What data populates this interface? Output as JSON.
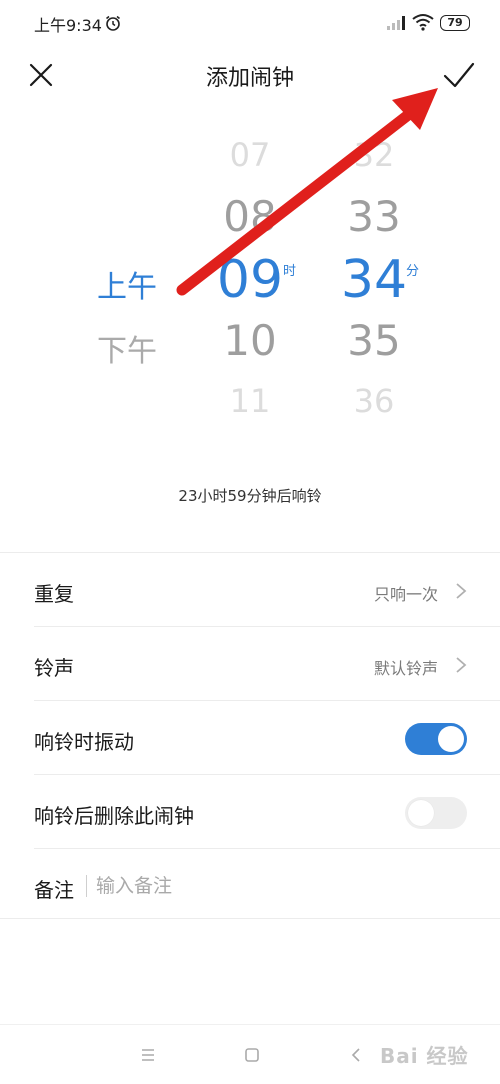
{
  "status_bar": {
    "time": "上午9:34",
    "battery": "79"
  },
  "header": {
    "title": "添加闹钟"
  },
  "picker": {
    "ampm": {
      "selected": "上午",
      "other": "下午"
    },
    "hours": {
      "far_above": "07",
      "near_above": "08",
      "selected": "09",
      "near_below": "10",
      "far_below": "11",
      "unit": "时"
    },
    "minutes": {
      "far_above": "32",
      "near_above": "33",
      "selected": "34",
      "near_below": "35",
      "far_below": "36",
      "unit": "分"
    }
  },
  "hint": "23小时59分钟后响铃",
  "settings": {
    "repeat": {
      "label": "重复",
      "value": "只响一次"
    },
    "ringtone": {
      "label": "铃声",
      "value": "默认铃声"
    },
    "vibrate": {
      "label": "响铃时振动",
      "on": true
    },
    "delete_after": {
      "label": "响铃后删除此闹钟",
      "on": false
    },
    "note": {
      "label": "备注",
      "placeholder": "输入备注"
    }
  },
  "watermark": "Bai 经验",
  "colors": {
    "accent": "#2f7fd6",
    "annotation": "#e0201c"
  }
}
